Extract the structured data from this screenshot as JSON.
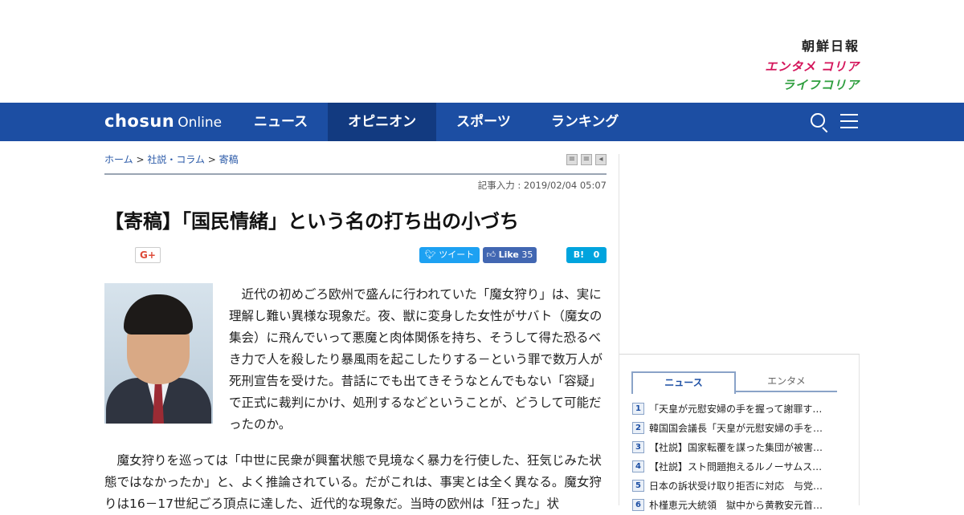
{
  "brand": {
    "newspaper": "朝鮮日報",
    "entame": "エンタメ コリア",
    "life": "ライフコリア"
  },
  "nav": {
    "logo_bold": "chosun",
    "logo_light": "Online",
    "items": [
      {
        "label": "ニュース",
        "active": false
      },
      {
        "label": "オピニオン",
        "active": true
      },
      {
        "label": "スポーツ",
        "active": false
      },
      {
        "label": "ランキング",
        "active": false
      }
    ]
  },
  "breadcrumb": {
    "home": "ホーム",
    "category": "社説・コラム",
    "current": "寄稿",
    "separator": " > "
  },
  "article": {
    "date": "記事入力 : 2019/02/04 05:07",
    "headline": "【寄稿】「国民情緒」という名の打ち出の小づち",
    "para1": "近代の初めごろ欧州で盛んに行われていた「魔女狩り」は、実に理解し難い異様な現象だ。夜、獣に変身した女性がサバト（魔女の集会）に飛んでいって悪魔と肉体関係を持ち、そうして得た恐るべき力で人を殺したり暴風雨を起こしたりする－という罪で数万人が死刑宣告を受けた。昔話にでも出てきそうなとんでもない「容疑」で正式に裁判にかけ、処刑するなどということが、どうして可能だったのか。",
    "para2": "魔女狩りを巡っては「中世に民衆が興奮状態で見境なく暴力を行使した、狂気じみた状態ではなかったか」と、よく推論されている。だがこれは、事実とは全く異なる。魔女狩りは16－17世紀ごろ頂点に達した、近代的な現象だ。当時の欧州は「狂った」状"
  },
  "share": {
    "gplus": "G+",
    "tweet": "ツイート",
    "like": "Like",
    "like_count": "35",
    "hatena": "B!",
    "hatena_count": "0"
  },
  "sidebar": {
    "tabs": [
      "ニュース",
      "エンタメ"
    ],
    "news": [
      {
        "rank": "1",
        "title": "「天皇が元慰安婦の手を握って謝罪す…"
      },
      {
        "rank": "2",
        "title": "韓国国会議長「天皇が元慰安婦の手を…"
      },
      {
        "rank": "3",
        "title": "【社説】国家転覆を謀った集団が被害…"
      },
      {
        "rank": "4",
        "title": "【社説】スト問題抱えるルノーサムス…"
      },
      {
        "rank": "5",
        "title": "日本の訴状受け取り拒否に対応　与党…"
      },
      {
        "rank": "6",
        "title": "朴槿恵元大統領　獄中から黄教安元首…"
      }
    ]
  },
  "colors": {
    "nav_bg": "#1c4ea3",
    "nav_active": "#123a80",
    "entame": "#d4145a",
    "life": "#2e9e3e"
  }
}
